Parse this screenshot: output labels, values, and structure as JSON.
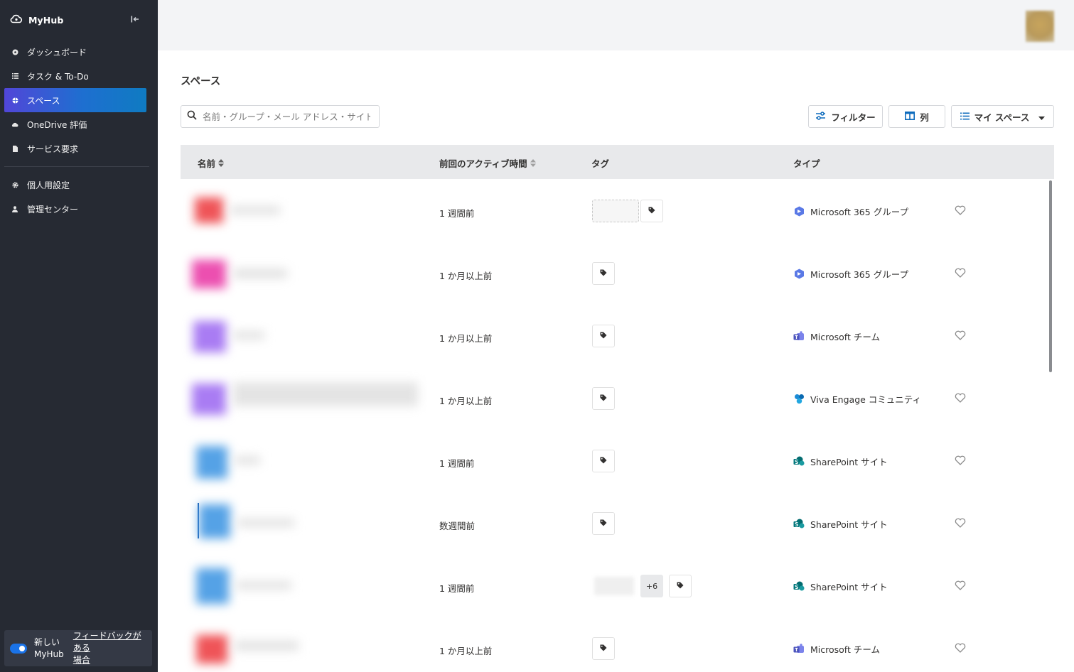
{
  "app": {
    "name": "MyHub",
    "collapse_icon": "collapse-sidebar-icon"
  },
  "sidebar": {
    "items": [
      {
        "label": "ダッシュボード",
        "icon": "dashboard-icon",
        "active": false
      },
      {
        "label": "タスク & To-Do",
        "icon": "tasks-icon",
        "active": false
      },
      {
        "label": "スペース",
        "icon": "spaces-icon",
        "active": true
      },
      {
        "label": "OneDrive 評価",
        "icon": "cloud-icon",
        "active": false
      },
      {
        "label": "サービス要求",
        "icon": "document-icon",
        "active": false
      }
    ],
    "bottom_items": [
      {
        "label": "個人用設定",
        "icon": "gear-icon"
      },
      {
        "label": "管理センター",
        "icon": "person-icon"
      }
    ],
    "footer": {
      "toggle_on": true,
      "toggle_label_line1": "新しい",
      "toggle_label_line2": "MyHub",
      "feedback_line1": "フィードバックがある",
      "feedback_line2": "場合"
    }
  },
  "main": {
    "title": "スペース",
    "search": {
      "placeholder": "名前・グループ・メール アドレス・サイト URL..."
    },
    "toolbar": {
      "filter_label": "フィルター",
      "columns_label": "列",
      "view_label": "マイ スペース"
    },
    "table": {
      "columns": {
        "name": "名前",
        "last_active": "前回のアクティブ時間",
        "tags": "タグ",
        "type": "タイプ"
      },
      "rows": [
        {
          "time": "1 週間前",
          "type": "Microsoft 365 グループ",
          "type_icon": "m365-group-icon",
          "tag_extra": null,
          "has_tag_chip": true
        },
        {
          "time": "1 か月以上前",
          "type": "Microsoft 365 グループ",
          "type_icon": "m365-group-icon",
          "tag_extra": null,
          "has_tag_chip": false
        },
        {
          "time": "1 か月以上前",
          "type": "Microsoft チーム",
          "type_icon": "teams-icon",
          "tag_extra": null,
          "has_tag_chip": false
        },
        {
          "time": "1 か月以上前",
          "type": "Viva Engage コミュニティ",
          "type_icon": "viva-engage-icon",
          "tag_extra": null,
          "has_tag_chip": false
        },
        {
          "time": "1 週間前",
          "type": "SharePoint サイト",
          "type_icon": "sharepoint-icon",
          "tag_extra": null,
          "has_tag_chip": false
        },
        {
          "time": "数週間前",
          "type": "SharePoint サイト",
          "type_icon": "sharepoint-icon",
          "tag_extra": null,
          "has_tag_chip": false
        },
        {
          "time": "1 週間前",
          "type": "SharePoint サイト",
          "type_icon": "sharepoint-icon",
          "tag_extra": "+6",
          "has_tag_chip": true
        },
        {
          "time": "1 か月以上前",
          "type": "Microsoft チーム",
          "type_icon": "teams-icon",
          "tag_extra": null,
          "has_tag_chip": false
        }
      ]
    }
  },
  "colors": {
    "sidebar_bg": "#262a33",
    "active_gradient_start": "#5146d8",
    "active_gradient_end": "#0f7bc2",
    "topbar_bg": "#f3f4f6",
    "header_bg": "#e8e9eb",
    "accent": "#1a73e8"
  }
}
